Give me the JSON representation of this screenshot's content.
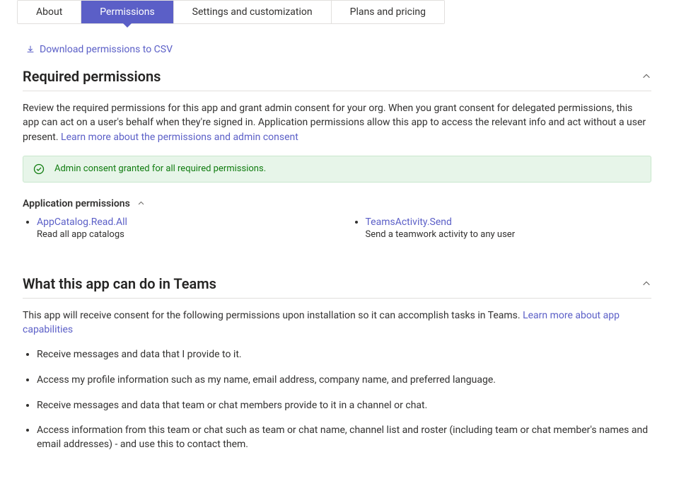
{
  "tabs": {
    "about": "About",
    "permissions": "Permissions",
    "settings": "Settings and customization",
    "plans": "Plans and pricing"
  },
  "download_link": "Download permissions to CSV",
  "required_permissions": {
    "title": "Required permissions",
    "description_pre": "Review the required permissions for this app and grant admin consent for your org. When you grant consent for delegated permissions, this app can act on a user's behalf when they're signed in. Application permissions allow this app to access the relevant info and act without a user present. ",
    "learn_more": "Learn more about the permissions and admin consent",
    "consent_banner": "Admin consent granted for all required permissions.",
    "app_permissions_title": "Application permissions",
    "permissions": [
      {
        "name": "AppCatalog.Read.All",
        "desc": "Read all app catalogs"
      },
      {
        "name": "TeamsActivity.Send",
        "desc": "Send a teamwork activity to any user"
      }
    ]
  },
  "what_app_can_do": {
    "title": "What this app can do in Teams",
    "description_pre": "This app will receive consent for the following permissions upon installation so it can accomplish tasks in Teams. ",
    "learn_more": "Learn more about app capabilities",
    "capabilities": [
      "Receive messages and data that I provide to it.",
      "Access my profile information such as my name, email address, company name, and preferred language.",
      "Receive messages and data that team or chat members provide to it in a channel or chat.",
      "Access information from this team or chat such as team or chat name, channel list and roster (including team or chat member's names and email addresses) - and use this to contact them."
    ]
  }
}
